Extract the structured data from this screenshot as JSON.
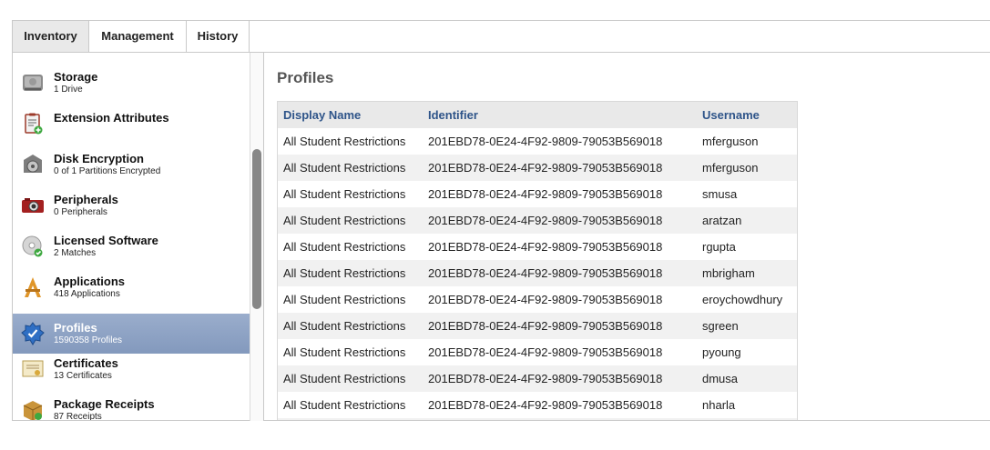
{
  "tabs": [
    {
      "label": "Inventory",
      "active": true
    },
    {
      "label": "Management",
      "active": false
    },
    {
      "label": "History",
      "active": false
    }
  ],
  "sidebar": {
    "items": [
      {
        "title": "Storage",
        "subtitle": "1 Drive",
        "icon": "hard-drive-icon"
      },
      {
        "title": "Extension Attributes",
        "subtitle": "",
        "icon": "clipboard-add-icon"
      },
      {
        "title": "Disk Encryption",
        "subtitle": "0 of 1 Partitions Encrypted",
        "icon": "filevault-icon"
      },
      {
        "title": "Peripherals",
        "subtitle": "0 Peripherals",
        "icon": "camera-icon"
      },
      {
        "title": "Licensed Software",
        "subtitle": "2 Matches",
        "icon": "licensed-disc-icon"
      },
      {
        "title": "Applications",
        "subtitle": "418 Applications",
        "icon": "applications-icon"
      },
      {
        "title": "Profiles",
        "subtitle": "1590358 Profiles",
        "icon": "profile-badge-icon",
        "selected": true
      },
      {
        "title": "Certificates",
        "subtitle": "13 Certificates",
        "icon": "certificate-icon"
      },
      {
        "title": "Package Receipts",
        "subtitle": "87 Receipts",
        "icon": "package-icon"
      }
    ]
  },
  "main": {
    "title": "Profiles",
    "columns": [
      "Display Name",
      "Identifier",
      "Username"
    ],
    "rows": [
      [
        "All Student Restrictions",
        "201EBD78-0E24-4F92-9809-79053B569018",
        "mferguson"
      ],
      [
        "All Student Restrictions",
        "201EBD78-0E24-4F92-9809-79053B569018",
        "mferguson"
      ],
      [
        "All Student Restrictions",
        "201EBD78-0E24-4F92-9809-79053B569018",
        "smusa"
      ],
      [
        "All Student Restrictions",
        "201EBD78-0E24-4F92-9809-79053B569018",
        "aratzan"
      ],
      [
        "All Student Restrictions",
        "201EBD78-0E24-4F92-9809-79053B569018",
        "rgupta"
      ],
      [
        "All Student Restrictions",
        "201EBD78-0E24-4F92-9809-79053B569018",
        "mbrigham"
      ],
      [
        "All Student Restrictions",
        "201EBD78-0E24-4F92-9809-79053B569018",
        "eroychowdhury"
      ],
      [
        "All Student Restrictions",
        "201EBD78-0E24-4F92-9809-79053B569018",
        "sgreen"
      ],
      [
        "All Student Restrictions",
        "201EBD78-0E24-4F92-9809-79053B569018",
        "pyoung"
      ],
      [
        "All Student Restrictions",
        "201EBD78-0E24-4F92-9809-79053B569018",
        "dmusa"
      ],
      [
        "All Student Restrictions",
        "201EBD78-0E24-4F92-9809-79053B569018",
        "nharla"
      ],
      [
        "",
        "",
        ""
      ]
    ]
  },
  "colors": {
    "selection": "#8da1c4",
    "header_text": "#2e5489",
    "row_alt": "#f1f1f1"
  }
}
